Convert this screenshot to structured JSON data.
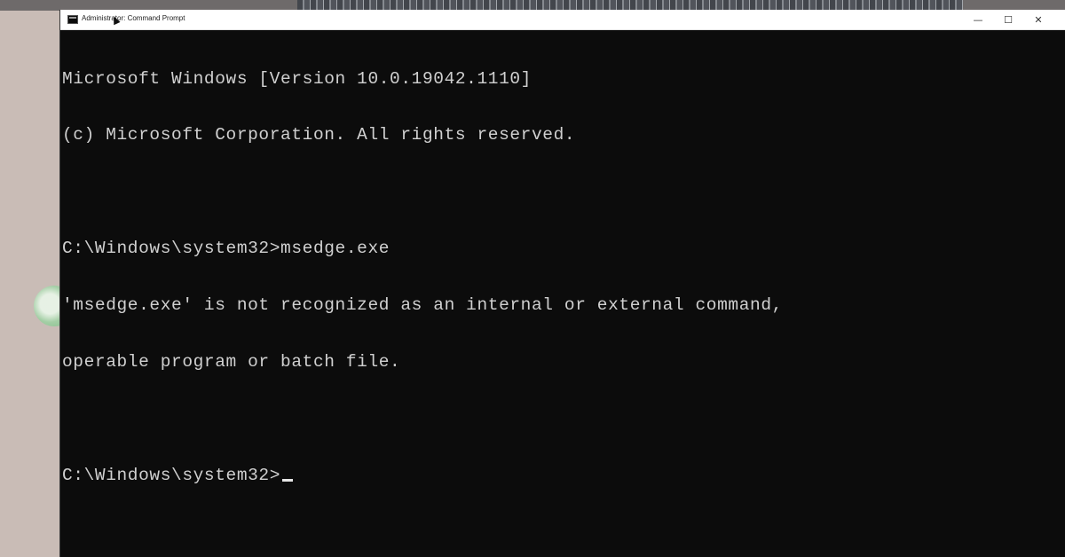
{
  "window": {
    "title": "Administrator: Command Prompt",
    "controls": {
      "minimize": "—",
      "maximize": "☐",
      "close": "✕"
    }
  },
  "console": {
    "lines": [
      "Microsoft Windows [Version 10.0.19042.1110]",
      "(c) Microsoft Corporation. All rights reserved.",
      "",
      "C:\\Windows\\system32>msedge.exe",
      "'msedge.exe' is not recognized as an internal or external command,",
      "operable program or batch file.",
      "",
      "C:\\Windows\\system32>"
    ],
    "background": "#0c0c0c",
    "foreground": "#d0d0d0"
  }
}
